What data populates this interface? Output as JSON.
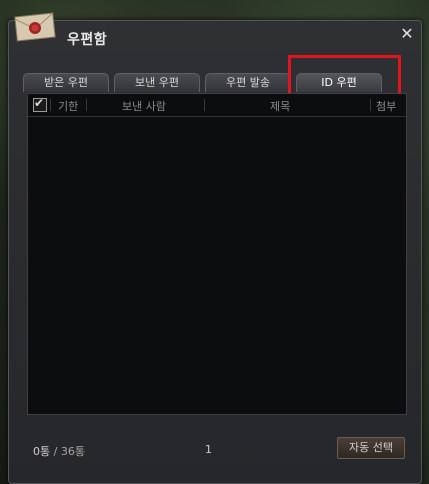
{
  "window": {
    "title": "우편함",
    "close_icon": "close-icon"
  },
  "tabs": [
    {
      "label": "받은 우편",
      "active": false
    },
    {
      "label": "보낸 우편",
      "active": false
    },
    {
      "label": "우편 발송",
      "active": false
    },
    {
      "label": "ID 우편",
      "active": true
    }
  ],
  "list": {
    "columns": [
      "기한",
      "보낸 사람",
      "제목",
      "첨부"
    ],
    "select_all_checked": true,
    "rows": []
  },
  "footer": {
    "count_current": "0통",
    "count_separator": " / ",
    "count_total": "36통",
    "page": "1",
    "auto_select_label": "자동 선택"
  },
  "colors": {
    "highlight": "#e0141c",
    "panel_bg": "#0c0d0e"
  }
}
